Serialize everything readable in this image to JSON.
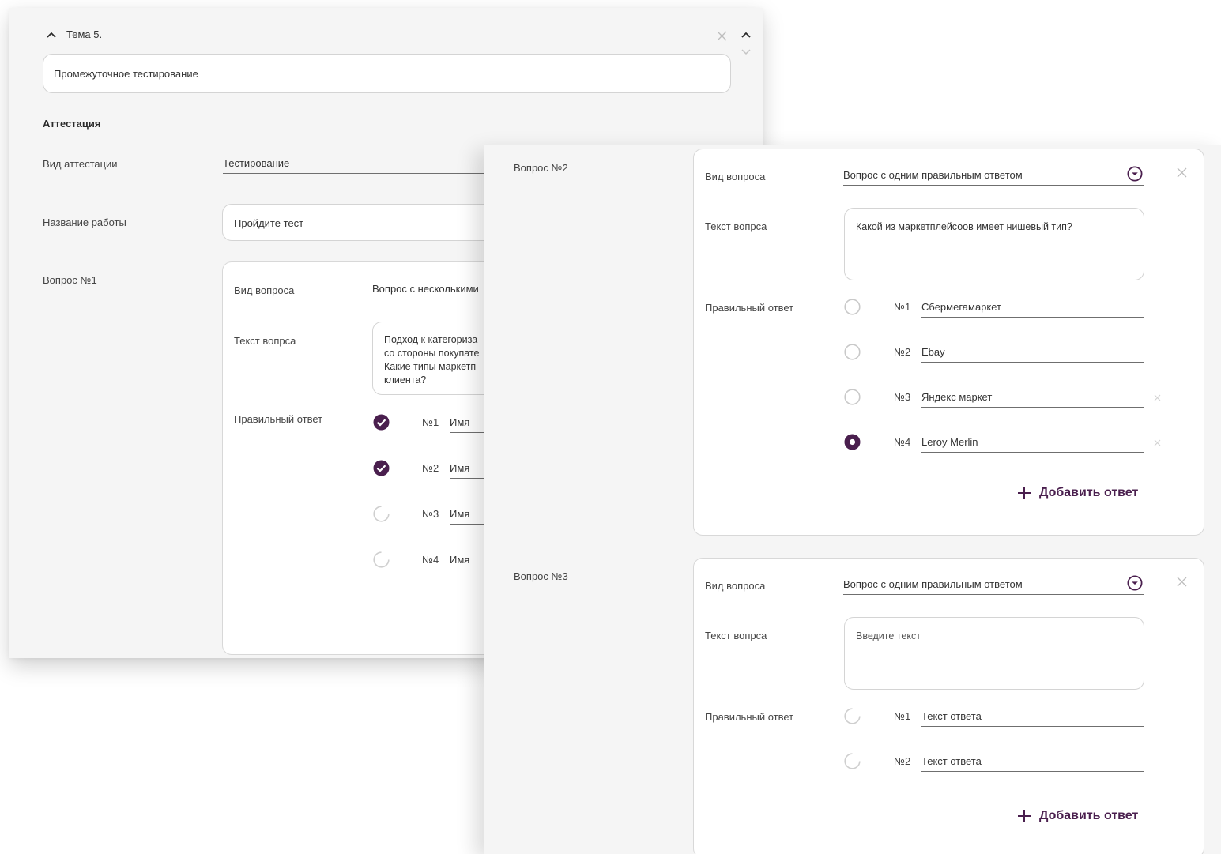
{
  "colors": {
    "accent": "#4a1f4e",
    "panel_bg": "#f5f5f5",
    "field_line": "#6f6f6f"
  },
  "topic": {
    "title": "Тема 5.",
    "name_value": "Промежуточное тестирование"
  },
  "attestation": {
    "heading": "Аттестация",
    "type_label": "Вид аттестации",
    "type_value": "Тестирование",
    "work_label": "Название работы",
    "work_value": "Пройдите тест"
  },
  "q1": {
    "label": "Вопрос №1",
    "kind_label": "Вид вопроса",
    "kind_value": "Вопрос с несколькими",
    "text_label": "Текст вопрса",
    "text_lines": [
      "Подход к категориза",
      "со стороны покупате",
      "Какие типы маркетп",
      "клиента?"
    ],
    "answer_label": "Правильный ответ",
    "answers": [
      {
        "num": "№1",
        "text": "Имя",
        "checked": true
      },
      {
        "num": "№2",
        "text": "Имя",
        "checked": true
      },
      {
        "num": "№3",
        "text": "Имя",
        "checked": false
      },
      {
        "num": "№4",
        "text": "Имя",
        "checked": false
      }
    ]
  },
  "q2": {
    "label": "Вопрос №2",
    "kind_label": "Вид вопроса",
    "kind_value": "Вопрос с одним правильным ответом",
    "text_label": "Текст вопрса",
    "text_value": "Какой из маркетплейсоов имеет нишевый тип?",
    "answer_label": "Правильный ответ",
    "answers": [
      {
        "num": "№1",
        "text": "Сбермегамаркет",
        "selected": false,
        "removable": false
      },
      {
        "num": "№2",
        "text": "Ebay",
        "selected": false,
        "removable": false
      },
      {
        "num": "№3",
        "text": "Яндекс маркет",
        "selected": false,
        "removable": true
      },
      {
        "num": "№4",
        "text": "Leroy Merlin",
        "selected": true,
        "removable": true
      }
    ],
    "add_label": "Добавить ответ"
  },
  "q3": {
    "label": "Вопрос №3",
    "kind_label": "Вид вопроса",
    "kind_value": "Вопрос с одним правильным ответом",
    "text_label": "Текст вопрса",
    "text_placeholder": "Введите текст",
    "answer_label": "Правильный ответ",
    "answers": [
      {
        "num": "№1",
        "text": "Текст ответа"
      },
      {
        "num": "№2",
        "text": "Текст ответа"
      }
    ],
    "add_label": "Добавить ответ"
  }
}
